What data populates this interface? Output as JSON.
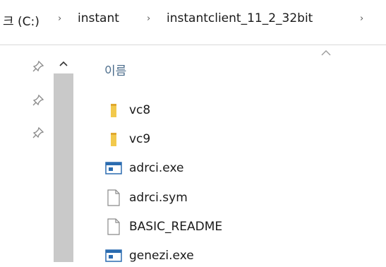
{
  "address_bar": {
    "segments": [
      "크 (C:)",
      "instant",
      "instantclient_11_2_32bit"
    ],
    "separator": "›"
  },
  "column": {
    "name_header": "이름"
  },
  "files": [
    {
      "name": "vc8",
      "icon": "folder-icon"
    },
    {
      "name": "vc9",
      "icon": "folder-icon"
    },
    {
      "name": "adrci.exe",
      "icon": "exe-icon"
    },
    {
      "name": "adrci.sym",
      "icon": "file-icon"
    },
    {
      "name": "BASIC_README",
      "icon": "file-icon"
    },
    {
      "name": "genezi.exe",
      "icon": "exe-icon"
    }
  ],
  "colors": {
    "folder": "#f2c94c",
    "scroll_thumb": "#c9c9c9",
    "header_text": "#4a6b8a",
    "exe_blue": "#2b6cb0"
  }
}
